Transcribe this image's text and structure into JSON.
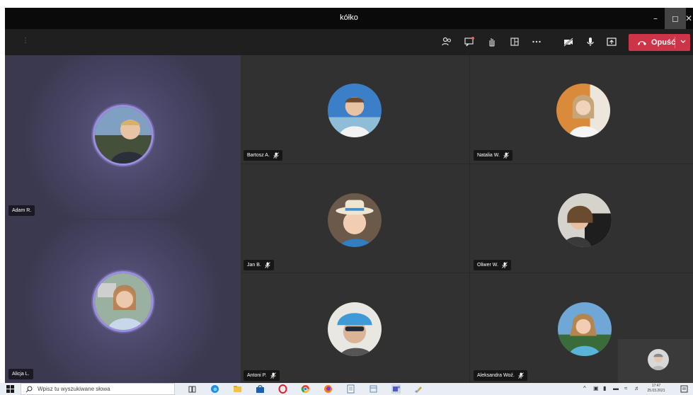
{
  "window": {
    "title": "kółko"
  },
  "toolbar": {
    "leave_label": "Opuść",
    "icons": [
      "participants-icon",
      "chat-icon",
      "raise-hand-icon",
      "rooms-icon",
      "more-options-icon",
      "camera-off-icon",
      "microphone-icon",
      "share-screen-icon"
    ],
    "leave_color": "#cc3547"
  },
  "participants": [
    {
      "name": "Adam R.",
      "pane": "left"
    },
    {
      "name": "Alicja L.",
      "pane": "left"
    },
    {
      "name": "Bartosz A.",
      "pane": "grid"
    },
    {
      "name": "Natalia W.",
      "pane": "grid"
    },
    {
      "name": "Jan B.",
      "pane": "grid"
    },
    {
      "name": "Oliwer W.",
      "pane": "grid"
    },
    {
      "name": "Antoni P.",
      "pane": "grid"
    },
    {
      "name": "Aleksandra Woź.",
      "pane": "grid"
    }
  ],
  "taskbar": {
    "search_placeholder": "Wpisz tu wyszukiwane słowa",
    "clock_time": "17:47",
    "clock_date": "25.03.2021"
  }
}
